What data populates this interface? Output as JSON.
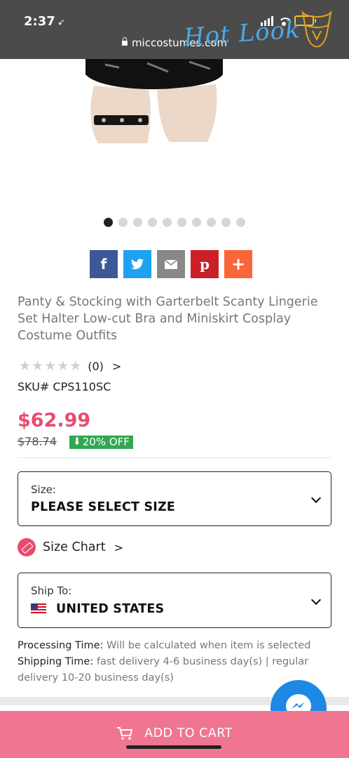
{
  "status_bar": {
    "time": "2:37",
    "location_arrow": "location-arrow-icon"
  },
  "browser": {
    "url": "miccostumes.com"
  },
  "watermark": {
    "text": "Hot Look"
  },
  "gallery": {
    "slide_count": 10,
    "active_index": 0
  },
  "share_buttons": [
    {
      "name": "facebook",
      "glyph": "f",
      "color": "#3b5998"
    },
    {
      "name": "twitter",
      "glyph": "t",
      "color": "#1da1f2"
    },
    {
      "name": "email",
      "glyph": "✉",
      "color": "#888888"
    },
    {
      "name": "pinterest",
      "glyph": "p",
      "color": "#cb2027"
    },
    {
      "name": "more",
      "glyph": "+",
      "color": "#fb6638"
    }
  ],
  "product": {
    "title": "Panty & Stocking with Garterbelt Scanty Lingerie Set Halter Low-cut Bra and Miniskirt Cosplay Costume Outfits",
    "rating_stars": 0,
    "rating_count": "(0)",
    "rating_arrow": ">",
    "sku": "SKU# CPS110SC",
    "price": "$62.99",
    "old_price": "$78.74",
    "discount": "20% OFF"
  },
  "size_select": {
    "label": "Size:",
    "value": "PLEASE SELECT SIZE"
  },
  "size_chart": {
    "label": "Size Chart",
    "arrow": ">"
  },
  "ship_select": {
    "label": "Ship To:",
    "value": "UNITED STATES"
  },
  "info": {
    "processing_label": "Processing Time:",
    "processing_value": " Will be calculated when item is selected",
    "shipping_label": "Shipping Time:",
    "shipping_value": " fast delivery 4-6 business day(s) | regular delivery 10-20 business day(s)"
  },
  "cart": {
    "label": "ADD TO CART"
  },
  "colors": {
    "accent": "#e94b6e",
    "cart_bar": "#f07591",
    "discount": "#2fa84f",
    "messenger": "#1e88e5"
  }
}
